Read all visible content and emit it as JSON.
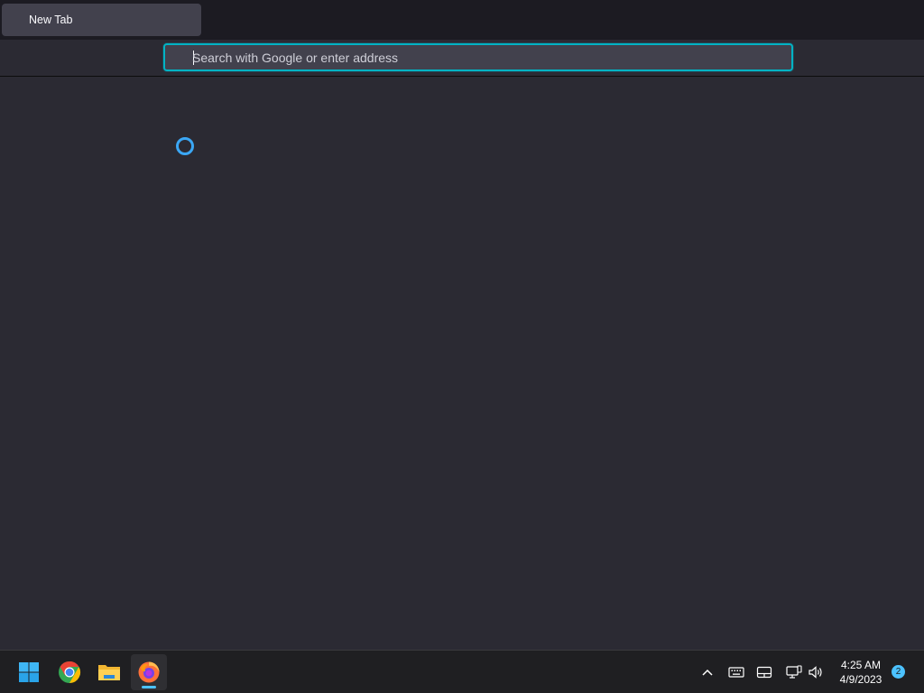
{
  "browser": {
    "tab": {
      "title": "New Tab"
    },
    "urlbar": {
      "placeholder": "Search with Google or enter address",
      "value": ""
    }
  },
  "taskbar": {
    "apps": [
      {
        "name": "start-icon"
      },
      {
        "name": "chrome-icon"
      },
      {
        "name": "file-explorer-icon"
      },
      {
        "name": "firefox-icon",
        "active": true
      }
    ],
    "tray": {
      "icons": [
        "chevron-up-icon",
        "keyboard-icon",
        "touchpad-icon",
        "network-icon",
        "volume-icon"
      ],
      "time": "4:25 AM",
      "date": "4/9/2023",
      "notification_count": "2"
    }
  },
  "colors": {
    "accent": "#00b3c4",
    "spinner": "#3ba7f5",
    "taskbar_indicator": "#4cc2ff"
  }
}
